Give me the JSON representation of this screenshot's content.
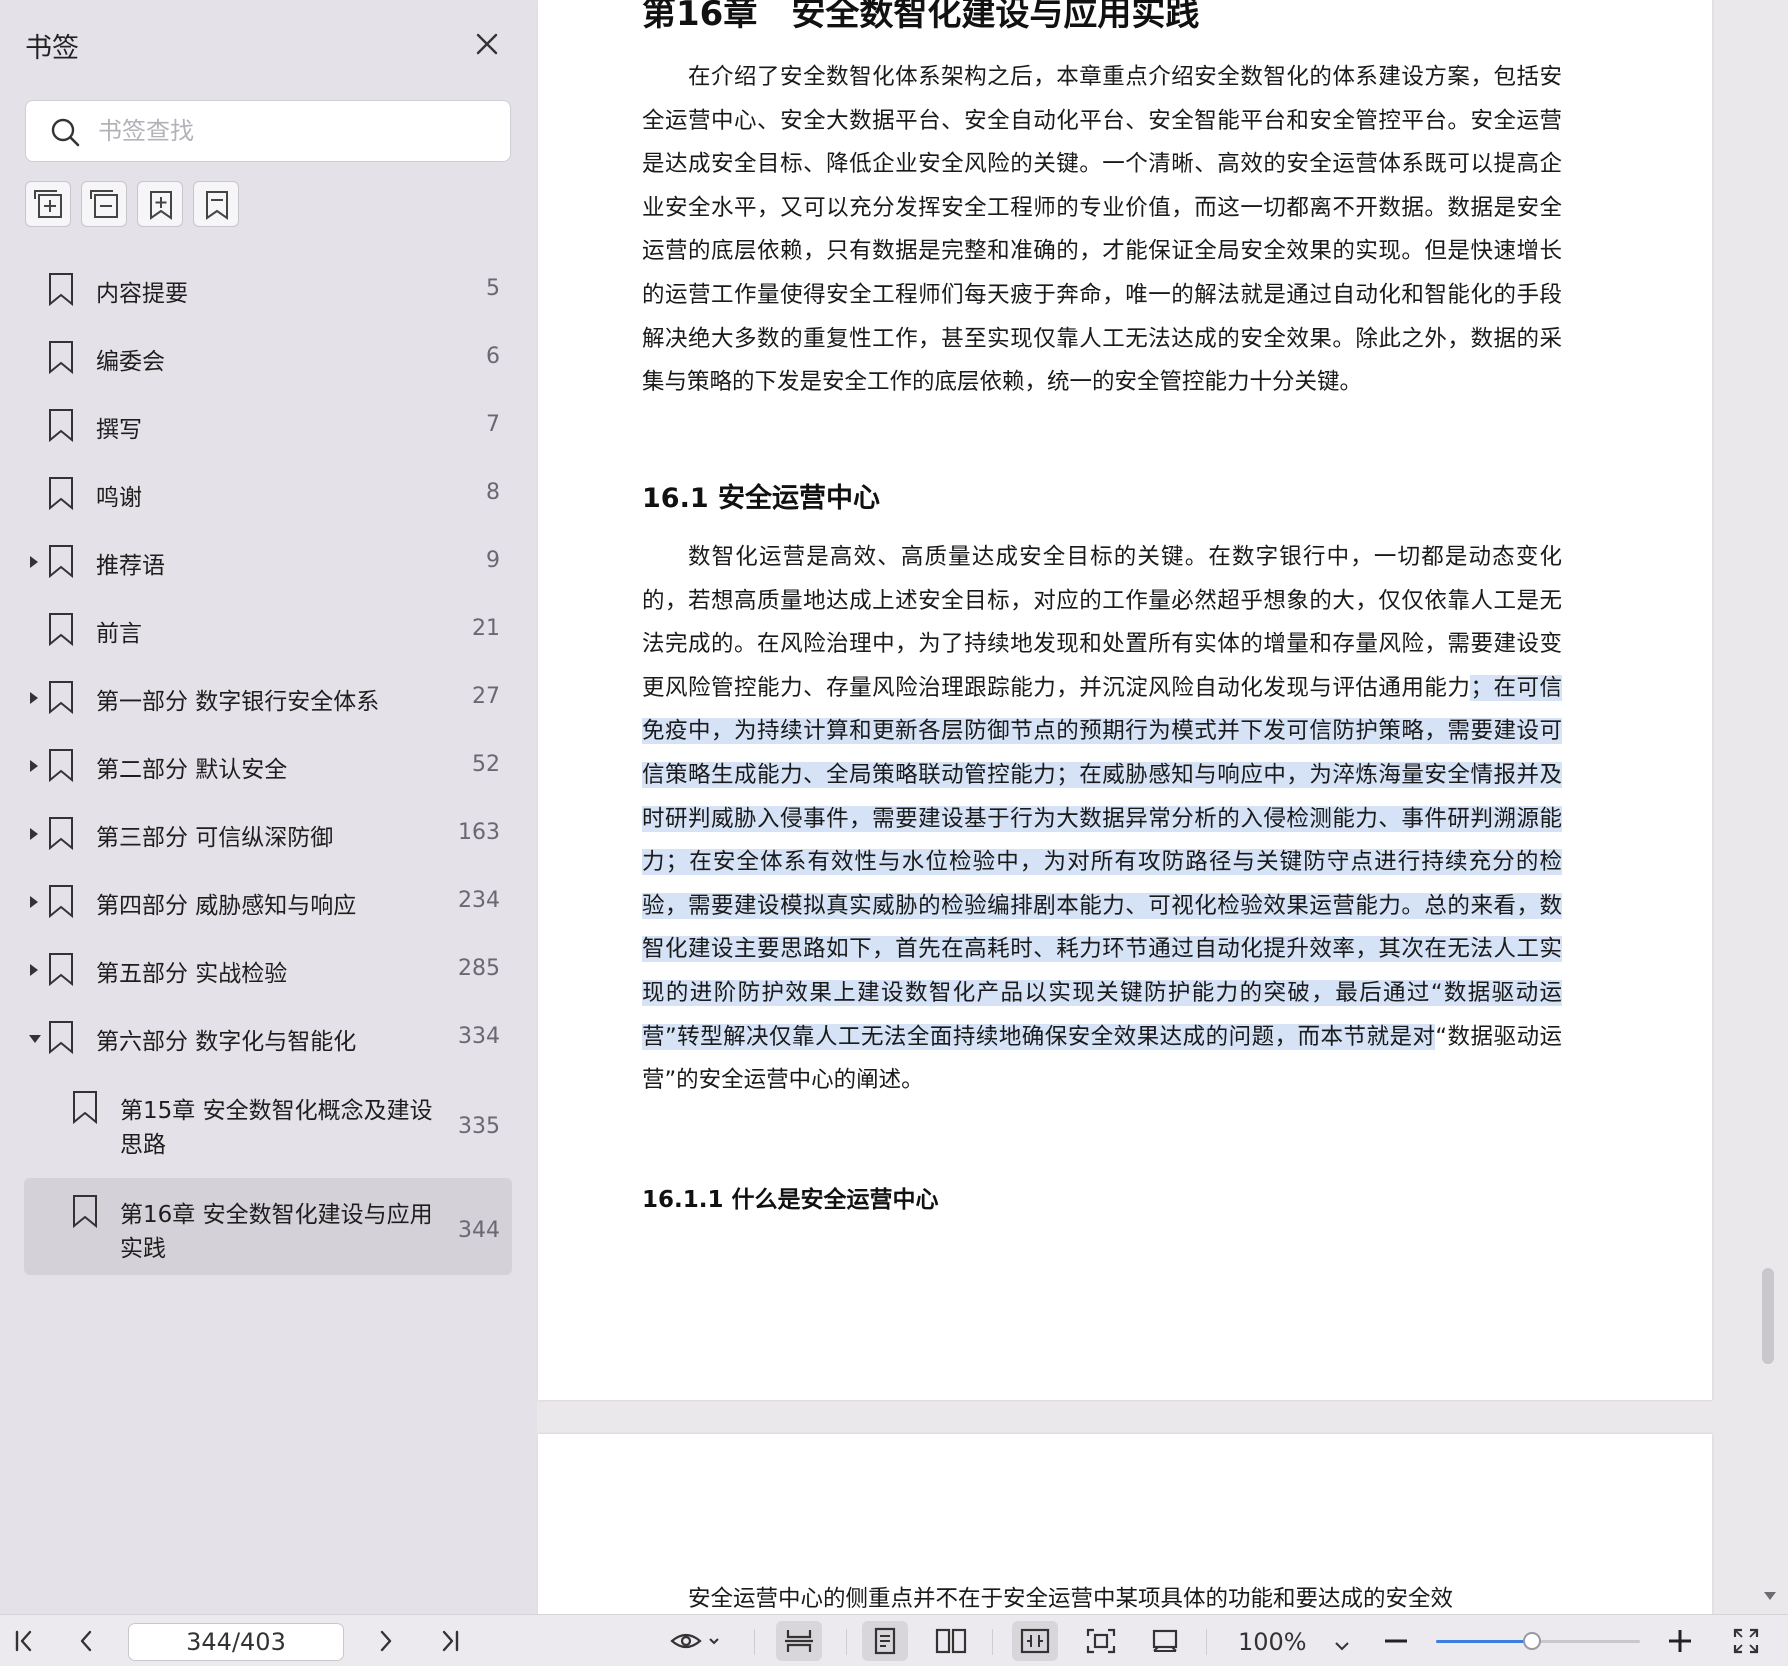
{
  "sidebar": {
    "title": "书签",
    "search_placeholder": "书签查找",
    "tools": [
      "expand-all-icon",
      "collapse-all-icon",
      "add-bookmark-icon",
      "bookmark-outline-icon"
    ],
    "items": [
      {
        "label": "内容提要",
        "page": "5",
        "expandable": false
      },
      {
        "label": "编委会",
        "page": "6",
        "expandable": false
      },
      {
        "label": "撰写",
        "page": "7",
        "expandable": false
      },
      {
        "label": "鸣谢",
        "page": "8",
        "expandable": false
      },
      {
        "label": "推荐语",
        "page": "9",
        "expandable": true,
        "expanded": false
      },
      {
        "label": "前言",
        "page": "21",
        "expandable": false
      },
      {
        "label": "第一部分 数字银行安全体系",
        "page": "27",
        "expandable": true,
        "expanded": false
      },
      {
        "label": "第二部分 默认安全",
        "page": "52",
        "expandable": true,
        "expanded": false
      },
      {
        "label": "第三部分 可信纵深防御",
        "page": "163",
        "expandable": true,
        "expanded": false
      },
      {
        "label": "第四部分 威胁感知与响应",
        "page": "234",
        "expandable": true,
        "expanded": false
      },
      {
        "label": "第五部分 实战检验",
        "page": "285",
        "expandable": true,
        "expanded": false
      },
      {
        "label": "第六部分 数字化与智能化",
        "page": "334",
        "expandable": true,
        "expanded": true
      },
      {
        "label": "第15章 安全数智化概念及建设思路",
        "page": "335",
        "child": true
      },
      {
        "label": "第16章 安全数智化建设与应用实践",
        "page": "344",
        "child": true,
        "selected": true
      }
    ]
  },
  "document": {
    "chapter_title": "第16章　安全数智化建设与应用实践",
    "para1": "在介绍了安全数智化体系架构之后，本章重点介绍安全数智化的体系建设方案，包括安全运营中心、安全大数据平台、安全自动化平台、安全智能平台和安全管控平台。安全运营是达成安全目标、降低企业安全风险的关键。一个清晰、高效的安全运营体系既可以提高企业安全水平，又可以充分发挥安全工程师的专业价值，而这一切都离不开数据。数据是安全运营的底层依赖，只有数据是完整和准确的，才能保证全局安全效果的实现。但是快速增长的运营工作量使得安全工程师们每天疲于奔命，唯一的解法就是通过自动化和智能化的手段解决绝大多数的重复性工作，甚至实现仅靠人工无法达成的安全效果。除此之外，数据的采集与策略的下发是安全工作的底层依赖，统一的安全管控能力十分关键。",
    "section1": "16.1 安全运营中心",
    "para2_normal_start": "数智化运营是高效、高质量达成安全目标的关键。在数字银行中，一切都是动态变化的，若想高质量地达成上述安全目标，对应的工作量必然超乎想象的大，仅仅依靠人工是无法完成的。在风险治理中，为了持续地发现和处置所有实体的增量和存量风险，需要建设变更风险管控能力、存量风险治理跟踪能力，并沉淀风险自动化发现与评估通用能力",
    "para2_highlighted": "；在可信免疫中，为持续计算和更新各层防御节点的预期行为模式并下发可信防护策略，需要建设可信策略生成能力、全局策略联动管控能力；在威胁感知与响应中，为淬炼海量安全情报并及时研判威胁入侵事件，需要建设基于行为大数据异常分析的入侵检测能力、事件研判溯源能力；在安全体系有效性与水位检验中，为对所有攻防路径与关键防守点进行持续充分的检验，需要建设模拟真实威胁的检验编排剧本能力、可视化检验效果运营能力。总的来看，数智化建设主要思路如下，首先在高耗时、耗力环节通过自动化提升效率，其次在无法人工实现的进阶防护效果上建设数智化产品以实现关键防护能力的突破，最后通过“数据驱动运营”转型解决仅靠人工无法全面持续地确保安全效果达成的问题，而本节就是对",
    "para2_normal_end": "“数据驱动运营”的安全运营中心的阐述。",
    "section2": "16.1.1 什么是安全运营中心",
    "page2_para": "安全运营中心的侧重点并不在于安全运营中某项具体的功能和要达成的安全效"
  },
  "toolbar": {
    "page_indicator": "344/403",
    "zoom_label": "100%",
    "zoom_fraction": 0.47,
    "highlight_color": "#d6e2f5",
    "accent_color": "#3b7de0"
  }
}
